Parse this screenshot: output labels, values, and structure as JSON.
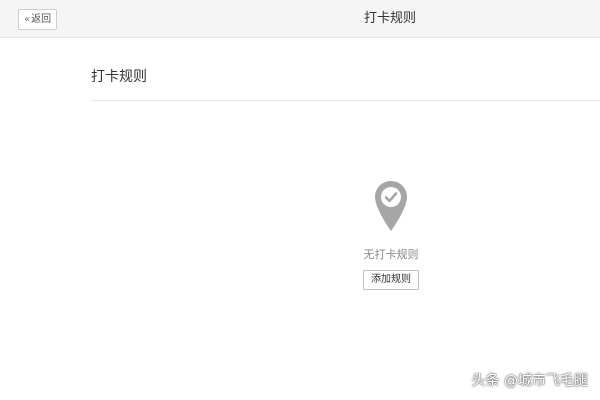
{
  "header": {
    "back_label": "返回",
    "back_icon": "double-chevron-left-icon",
    "title": "打卡规则"
  },
  "main": {
    "section_title": "打卡规则",
    "empty_state": {
      "icon": "location-pin-check-icon",
      "message": "无打卡规则",
      "add_button_label": "添加规则"
    }
  },
  "watermark": {
    "text": "头条 @城市飞毛腿"
  },
  "colors": {
    "header_bg": "#f5f5f5",
    "icon_gray": "#a6a6a6",
    "divider": "#e8e8e8"
  }
}
